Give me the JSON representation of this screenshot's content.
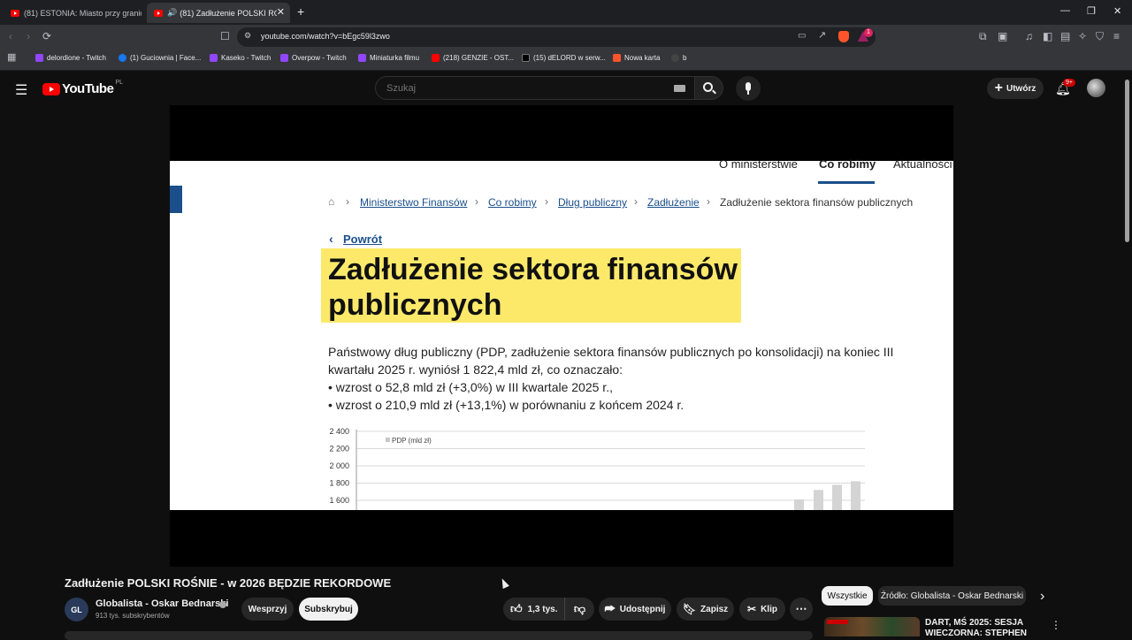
{
  "browser": {
    "tabs": [
      {
        "title": "(81) ESTONIA: Miasto przy granicy z ..."
      },
      {
        "title": "(81) Zadłużenie POLSKI ROŚN..."
      }
    ],
    "new_tab": "+",
    "url": "youtube.com/watch?v=bEgc59l3zwo",
    "extension_badge": "1",
    "bookmarks": [
      {
        "label": "delordione - Twitch",
        "color": "#9146ff"
      },
      {
        "label": "(1) Guciownia | Face...",
        "color": "#1877f2"
      },
      {
        "label": "Kaseko - Twitch",
        "color": "#9146ff"
      },
      {
        "label": "Overpow - Twitch",
        "color": "#9146ff"
      },
      {
        "label": "Miniaturka filmu",
        "color": "#9146ff"
      },
      {
        "label": "(218) GENZIE - OST...",
        "color": "#ff0000"
      },
      {
        "label": "(15) dELORD w serw...",
        "color": "#000000"
      },
      {
        "label": "Nowa karta",
        "color": "#fb542b"
      },
      {
        "label": "b",
        "color": "#444444"
      }
    ]
  },
  "youtube": {
    "logo_text": "YouTube",
    "region": "PL",
    "search_placeholder": "Szukaj",
    "create_label": "Utwórz",
    "notif_count": "9+"
  },
  "video_frame": {
    "site_nav": [
      "O ministerstwie",
      "Co robimy",
      "Aktualności"
    ],
    "breadcrumb": [
      "Ministerstwo Finansów",
      "Co robimy",
      "Dług publiczny",
      "Zadłużenie",
      "Zadłużenie sektora finansów publicznych"
    ],
    "back_link": "Powrót",
    "title": "Zadłużenie sektora finansów publicznych",
    "paragraph": [
      "Państwowy dług publiczny (PDP, zadłużenie sektora finansów publicznych po konsolidacji) na koniec III",
      "kwartału 2025 r. wyniósł 1 822,4 mld zł, co oznaczało:",
      "• wzrost o 52,8 mld zł (+3,0%) w III kwartale 2025 r.,",
      "• wzrost o 210,9 mld zł (+13,1%) w porównaniu z końcem 2024 r."
    ]
  },
  "chart_data": {
    "type": "bar",
    "legend": "PDP (mld zł)",
    "yticks": [
      "2 400",
      "2 200",
      "2 000",
      "1 800",
      "1 600"
    ],
    "ylim": [
      1600,
      2400
    ],
    "values": [
      1610,
      1720,
      1780,
      1822
    ]
  },
  "video_info": {
    "title": "Zadłużenie POLSKI ROŚNIE - w 2026 BĘDZIE REKORDOWE",
    "channel_name": "Globalista - Oskar Bednarski",
    "subscribers": "913 tys. subskrybentów",
    "support_label": "Wesprzyj",
    "subscribe_label": "Subskrybuj",
    "likes": "1,3 tys.",
    "share_label": "Udostępnij",
    "save_label": "Zapisz",
    "clip_label": "Klip"
  },
  "sidebar": {
    "chips": [
      "Wszystkie",
      "Źródło: Globalista - Oskar Bednarski"
    ],
    "first_video_title": "DART, MŚ 2025: SESJA WIECZORNA: STEPHEN"
  },
  "colors": {
    "accent": "#ff0000",
    "highlight": "#fce96a",
    "link": "#1a4f8b"
  }
}
